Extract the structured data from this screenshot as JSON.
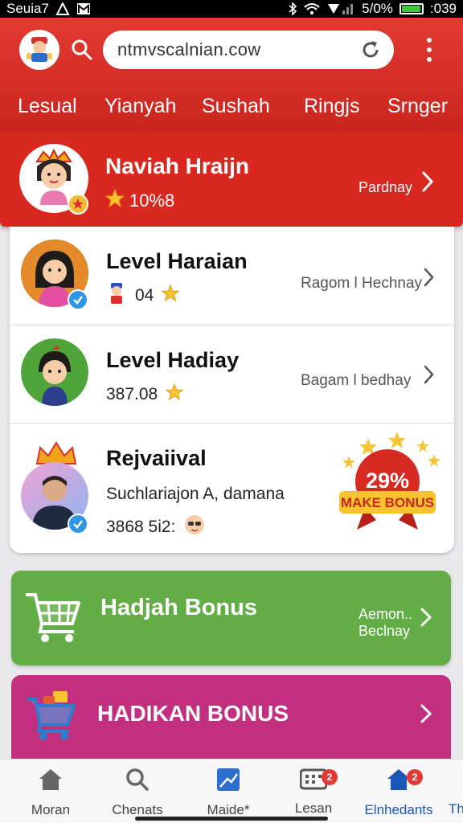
{
  "status_bar": {
    "carrier": "Seuia7",
    "battery": "5/0%",
    "time": ":039",
    "battery_level": 0.9
  },
  "header": {
    "url": "ntmvscalnian.cow",
    "tabs": [
      "Lesual",
      "Yianyah",
      "Sushah",
      "Ringjs",
      "Srnger"
    ]
  },
  "profile": {
    "name": "Naviah Hraijn",
    "score": "10%8",
    "link": "Pardnay"
  },
  "rows": [
    {
      "title": "Level Haraian",
      "sub": "04",
      "link": "Ragom l Hechnay"
    },
    {
      "title": "Level Hadiay",
      "sub": "387.08",
      "link": "Bagam l bedhay"
    },
    {
      "title": "Rejvaiival",
      "sub1": "Suchlariajon A, damana",
      "sub2": "3868 5i2:",
      "badge_percent": "29%",
      "badge_label": "MAKE BONUS"
    }
  ],
  "bonus_green": {
    "title": "Hadjah Bonus",
    "sub1": "Aemon..",
    "sub2": "Beclnay"
  },
  "bonus_pink": {
    "title": "HADIKAN BONUS"
  },
  "nav": [
    {
      "label": "Moran",
      "icon": "home-icon",
      "badge": ""
    },
    {
      "label": "Chenats",
      "icon": "search-icon",
      "badge": ""
    },
    {
      "label": "Maide*",
      "icon": "chart-icon",
      "badge": ""
    },
    {
      "label": "Lesan",
      "icon": "grid-icon",
      "badge": "2"
    },
    {
      "label": "Elnhedants",
      "icon": "home-icon",
      "badge": "2"
    },
    {
      "label": "Th",
      "icon": "",
      "badge": ""
    }
  ],
  "colors": {
    "header": "#d9281f",
    "green": "#63ad47",
    "pink": "#c12f7e",
    "active_nav": "#1a57b8"
  }
}
